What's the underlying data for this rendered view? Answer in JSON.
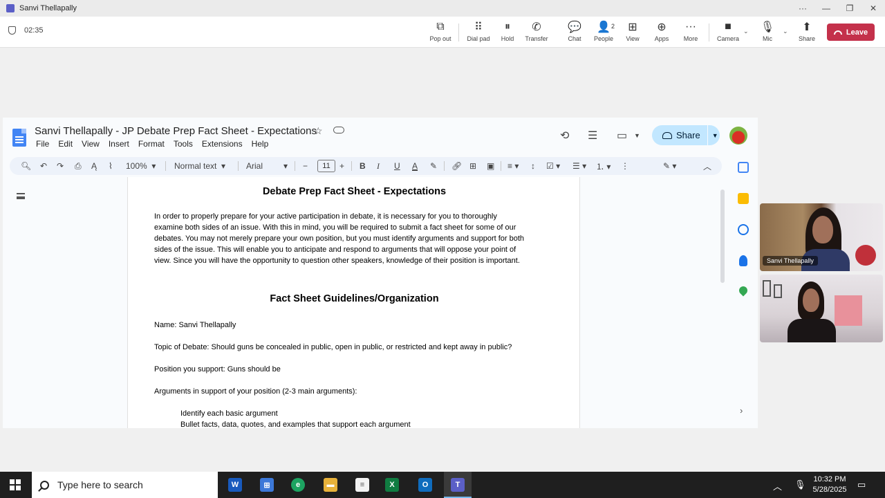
{
  "window": {
    "title": "Sanvi Thellapally"
  },
  "meeting": {
    "timer": "02:35",
    "tools": {
      "popout": "Pop out",
      "dialpad": "Dial pad",
      "hold": "Hold",
      "transfer": "Transfer",
      "chat": "Chat",
      "people": "People",
      "people_count": "2",
      "view": "View",
      "apps": "Apps",
      "more": "More",
      "camera": "Camera",
      "mic": "Mic",
      "share": "Share"
    },
    "leave_label": "Leave"
  },
  "docs": {
    "title": "Sanvi Thellapally - JP  Debate Prep Fact Sheet - Expectations",
    "menu": [
      "File",
      "Edit",
      "Insert",
      "Format",
      "Tools",
      "Extensions",
      "Help"
    ],
    "menu_view": "View",
    "share_label": "Share",
    "toolbar": {
      "zoom": "100%",
      "style": "Normal text",
      "font": "Arial",
      "font_size": "11"
    }
  },
  "document": {
    "heading1": "Debate Prep Fact Sheet - Expectations",
    "intro_lines": [
      "In order to properly prepare for your active participation in debate, it is necessary for you to thoroughly",
      "examine both sides of an issue. With this in mind, you will be required to submit a fact sheet for some of our",
      "debates. You may not merely prepare your own position, but you must identify arguments and support for both",
      "sides of the issue. This will enable you to anticipate and respond to arguments that will oppose your point of",
      "view. Since you will have the opportunity to question other speakers, knowledge of their position is important."
    ],
    "heading2": "Fact Sheet Guidelines/Organization",
    "name_line": "Name: Sanvi Thellapally",
    "topic_line": "Topic of Debate: Should guns be concealed in public, open in public, or restricted and kept away in public?",
    "position_line": "Position you support: Guns should be",
    "arguments_line": "Arguments in support of your position (2-3 main arguments):",
    "indent1": "Identify each basic argument",
    "indent2": "Bullet facts, data, quotes, and examples that support each argument"
  },
  "participants": [
    {
      "name": "Sanvi Thellapally"
    }
  ],
  "taskbar": {
    "search_placeholder": "Type here to search",
    "time": "10:32 PM",
    "date": "5/28/2025"
  },
  "colors": {
    "leave": "#c4314b",
    "share_button": "#c2e7ff",
    "docs_blue": "#4285f4",
    "taskbar": "#1f1f1f"
  }
}
